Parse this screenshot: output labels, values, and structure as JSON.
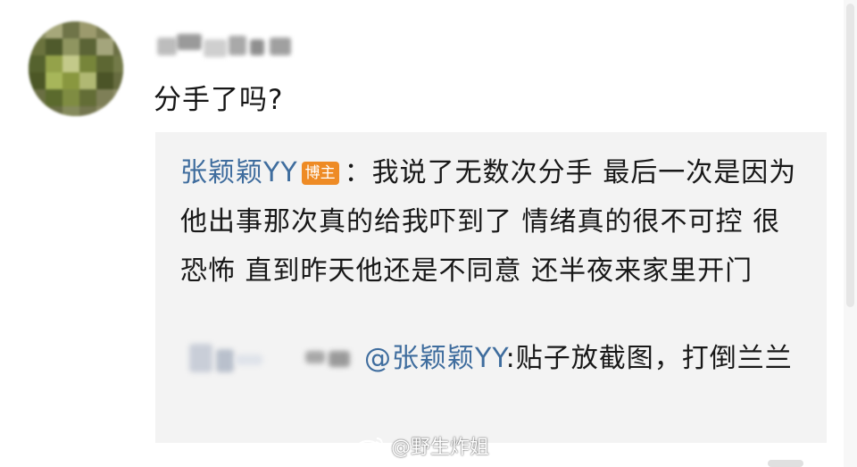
{
  "comment": {
    "avatar_icon": "blurred-avatar",
    "username_redacted": true,
    "text": "分手了吗?"
  },
  "reply": {
    "author": "张颖颖YY",
    "badge": "博主",
    "separator": "：",
    "text": "我说了无数次分手 最后一次是因为他出事那次真的给我吓到了 情绪真的很不可控 很恐怖  直到昨天他还是不同意 还半夜来家里开门"
  },
  "sub_reply": {
    "username_redacted": true,
    "mention": "@张颖颖YY",
    "text": ":贴子放截图，打倒兰兰"
  },
  "watermark": {
    "icon": "weibo-logo-icon",
    "text": "@野生炸姐"
  },
  "colors": {
    "link": "#3f6d9e",
    "badge": "#ee8b25",
    "reply_bg": "#f3f3f3"
  }
}
